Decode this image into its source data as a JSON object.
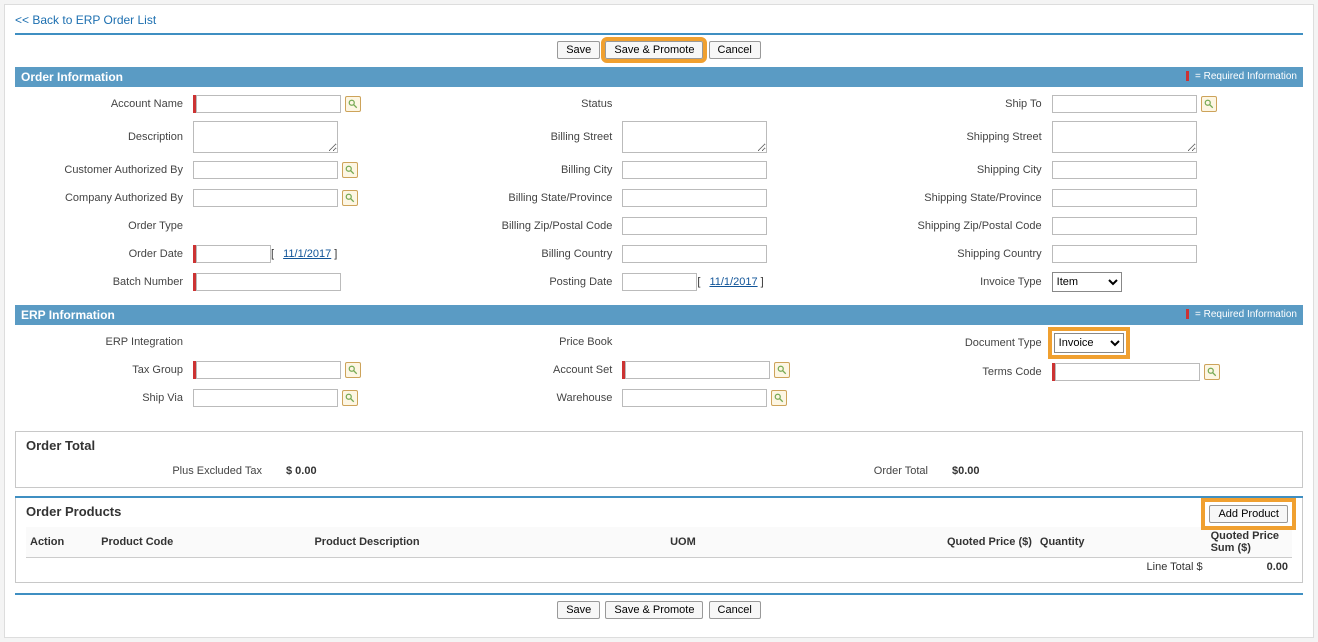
{
  "nav": {
    "back_link": "<< Back to ERP Order List"
  },
  "buttons": {
    "save": "Save",
    "save_promote": "Save & Promote",
    "cancel": "Cancel",
    "add_product": "Add Product"
  },
  "required_text": "= Required Information",
  "sections": {
    "order_info": "Order Information",
    "erp_info": "ERP Information",
    "order_total": "Order Total",
    "order_products": "Order Products"
  },
  "labels": {
    "account_name": "Account Name",
    "description": "Description",
    "cust_authorized_by": "Customer Authorized By",
    "comp_authorized_by": "Company Authorized By",
    "order_type": "Order Type",
    "order_date": "Order Date",
    "batch_number": "Batch Number",
    "status": "Status",
    "billing_street": "Billing Street",
    "billing_city": "Billing City",
    "billing_state": "Billing State/Province",
    "billing_zip": "Billing Zip/Postal Code",
    "billing_country": "Billing Country",
    "posting_date": "Posting Date",
    "ship_to": "Ship To",
    "shipping_street": "Shipping Street",
    "shipping_city": "Shipping City",
    "shipping_state": "Shipping State/Province",
    "shipping_zip": "Shipping Zip/Postal Code",
    "shipping_country": "Shipping Country",
    "invoice_type": "Invoice Type",
    "erp_integration": "ERP Integration",
    "tax_group": "Tax Group",
    "ship_via": "Ship Via",
    "price_book": "Price Book",
    "account_set": "Account Set",
    "warehouse": "Warehouse",
    "document_type": "Document Type",
    "terms_code": "Terms Code",
    "plus_excluded_tax": "Plus Excluded Tax",
    "order_total": "Order Total",
    "line_total": "Line Total $"
  },
  "values": {
    "order_date_link": "11/1/2017",
    "posting_date_link": "11/1/2017",
    "invoice_type_selected": "Item",
    "document_type_selected": "Invoice",
    "plus_excluded_tax": "$ 0.00",
    "order_total": "$0.00",
    "line_total": "0.00"
  },
  "product_columns": {
    "action": "Action",
    "product_code": "Product Code",
    "product_description": "Product Description",
    "uom": "UOM",
    "quoted_price": "Quoted Price ($)",
    "quantity": "Quantity",
    "quoted_price_sum": "Quoted Price Sum ($)"
  }
}
